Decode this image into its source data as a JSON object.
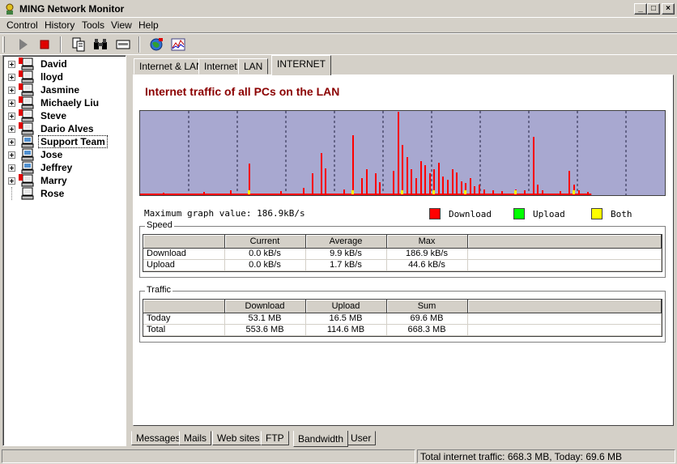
{
  "window": {
    "title": "MING Network Monitor",
    "minimize_glyph": "_",
    "maximize_glyph": "□",
    "close_glyph": "×"
  },
  "menu": [
    "Control",
    "History",
    "Tools",
    "View",
    "Help"
  ],
  "toolbar_icons": [
    "play-icon",
    "stop-icon",
    "copy-icon",
    "binoculars-icon",
    "card-icon",
    "network-globe-icon",
    "chart-icon"
  ],
  "tree": {
    "items": [
      {
        "label": "David",
        "status": "offline"
      },
      {
        "label": "lloyd",
        "status": "offline"
      },
      {
        "label": "Jasmine",
        "status": "offline"
      },
      {
        "label": "Michaely Liu",
        "status": "offline"
      },
      {
        "label": "Steve",
        "status": "offline"
      },
      {
        "label": "Dario Alves",
        "status": "offline"
      },
      {
        "label": "Support Team",
        "status": "online",
        "selected": true
      },
      {
        "label": "Jose",
        "status": "online"
      },
      {
        "label": "Jeffrey",
        "status": "online"
      },
      {
        "label": "Marry",
        "status": "offline"
      },
      {
        "label": "Rose",
        "status": "none"
      }
    ]
  },
  "top_tabs": [
    "Internet & LAN",
    "Internet",
    "LAN",
    "INTERNET"
  ],
  "active_top_tab": "INTERNET",
  "heading": "Internet traffic of all PCs on the LAN",
  "graph": {
    "max_label": "Maximum graph value: 186.9kB/s",
    "colors": {
      "background": "#a8a8d0",
      "download": "#ff0000",
      "upload": "#00ff00",
      "both": "#ffff00"
    },
    "legend": [
      {
        "label": "Download",
        "color": "#ff0000"
      },
      {
        "label": "Upload",
        "color": "#00ff00"
      },
      {
        "label": "Both",
        "color": "#ffff00"
      }
    ],
    "spikes": [
      [
        0.05,
        0.02
      ],
      [
        0.14,
        0.03
      ],
      [
        0.2,
        0.05
      ],
      [
        0.24,
        0.37
      ],
      [
        0.31,
        0.04
      ],
      [
        0.36,
        0.08
      ],
      [
        0.38,
        0.25
      ],
      [
        0.4,
        0.5
      ],
      [
        0.41,
        0.31
      ],
      [
        0.45,
        0.06
      ],
      [
        0.47,
        0.72
      ],
      [
        0.49,
        0.2
      ],
      [
        0.5,
        0.3
      ],
      [
        0.52,
        0.25
      ],
      [
        0.53,
        0.15
      ],
      [
        0.56,
        0.28
      ],
      [
        0.57,
        1.0
      ],
      [
        0.58,
        0.6
      ],
      [
        0.59,
        0.45
      ],
      [
        0.6,
        0.3
      ],
      [
        0.61,
        0.2
      ],
      [
        0.62,
        0.4
      ],
      [
        0.63,
        0.35
      ],
      [
        0.64,
        0.25
      ],
      [
        0.65,
        0.3
      ],
      [
        0.66,
        0.38
      ],
      [
        0.67,
        0.22
      ],
      [
        0.68,
        0.18
      ],
      [
        0.69,
        0.3
      ],
      [
        0.7,
        0.26
      ],
      [
        0.71,
        0.16
      ],
      [
        0.72,
        0.14
      ],
      [
        0.73,
        0.2
      ],
      [
        0.74,
        0.1
      ],
      [
        0.75,
        0.12
      ],
      [
        0.76,
        0.06
      ],
      [
        0.78,
        0.05
      ],
      [
        0.8,
        0.04
      ],
      [
        0.83,
        0.06
      ],
      [
        0.85,
        0.05
      ],
      [
        0.87,
        0.7
      ],
      [
        0.88,
        0.12
      ],
      [
        0.89,
        0.05
      ],
      [
        0.93,
        0.04
      ],
      [
        0.95,
        0.28
      ],
      [
        0.96,
        0.12
      ],
      [
        0.97,
        0.05
      ],
      [
        0.99,
        0.03
      ]
    ]
  },
  "speed": {
    "title": "Speed",
    "columns": [
      "",
      "Current",
      "Average",
      "Max",
      ""
    ],
    "rows": [
      [
        "Download",
        "0.0 kB/s",
        "9.9 kB/s",
        "186.9 kB/s",
        ""
      ],
      [
        "Upload",
        "0.0 kB/s",
        "1.7 kB/s",
        "44.6 kB/s",
        ""
      ]
    ]
  },
  "traffic": {
    "title": "Traffic",
    "columns": [
      "",
      "Download",
      "Upload",
      "Sum",
      ""
    ],
    "rows": [
      [
        "Today",
        "53.1 MB",
        "16.5 MB",
        "69.6 MB",
        ""
      ],
      [
        "Total",
        "553.6 MB",
        "114.6 MB",
        "668.3 MB",
        ""
      ]
    ]
  },
  "bottom_tabs": [
    "Messages",
    "Mails",
    "Web sites",
    "FTP",
    "Bandwidth",
    "User"
  ],
  "active_bottom_tab": "Bandwidth",
  "status": {
    "right": "Total internet traffic: 668.3 MB, Today: 69.6 MB"
  }
}
